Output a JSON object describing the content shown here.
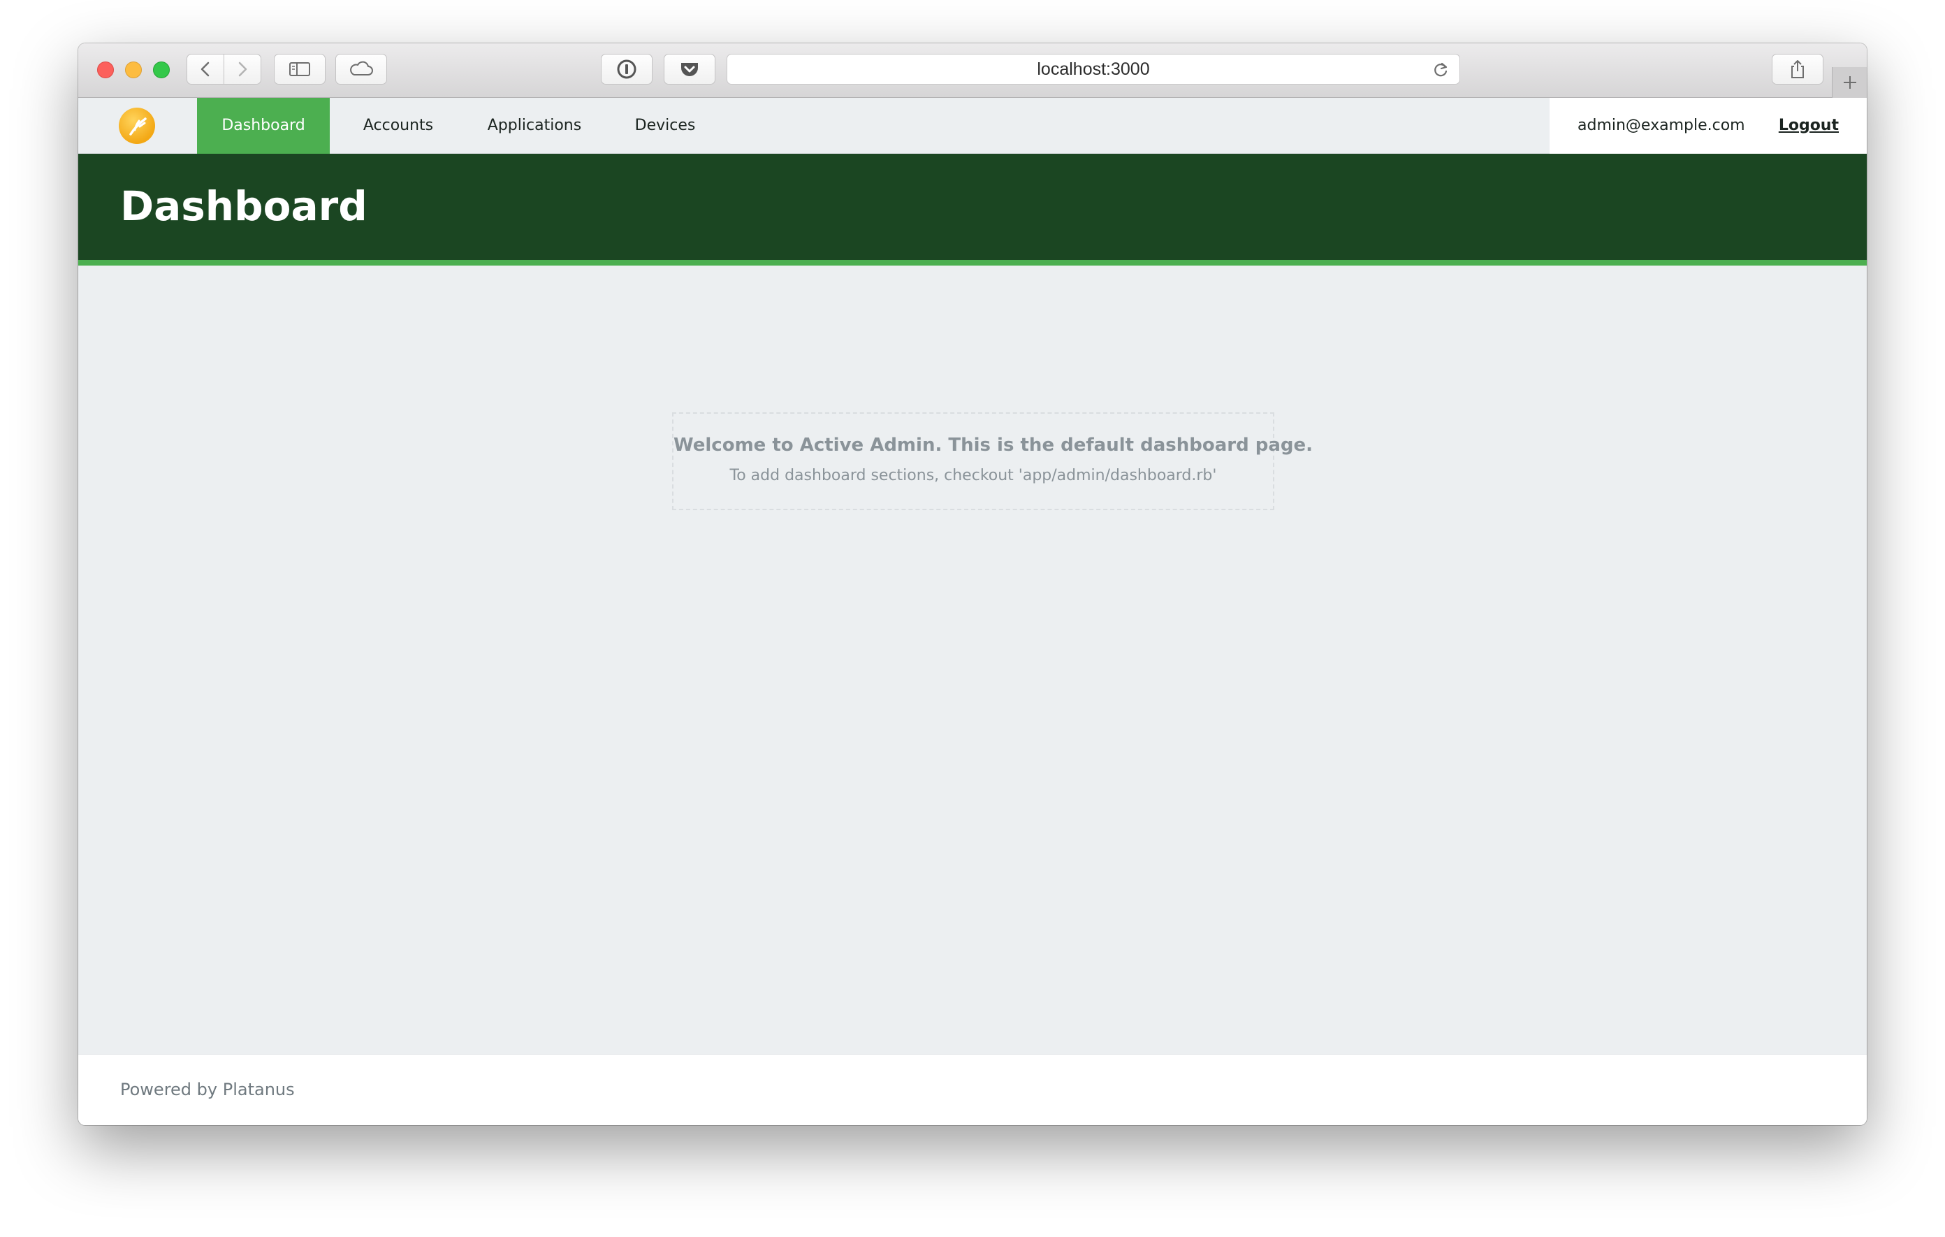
{
  "browser": {
    "url": "localhost:3000",
    "icons": {
      "back": "chevron-left-icon",
      "forward": "chevron-right-icon",
      "sidebar": "sidebar-icon",
      "cloud": "icloud-tabs-icon",
      "onepassword": "1password-icon",
      "pocket": "pocket-icon",
      "reload": "reload-icon",
      "share": "share-icon",
      "new_tab": "plus-icon"
    }
  },
  "nav": {
    "items": [
      {
        "label": "Dashboard",
        "active": true
      },
      {
        "label": "Accounts",
        "active": false
      },
      {
        "label": "Applications",
        "active": false
      },
      {
        "label": "Devices",
        "active": false
      }
    ],
    "user_email": "admin@example.com",
    "logout_label": "Logout"
  },
  "header": {
    "title": "Dashboard"
  },
  "main": {
    "blank_slate_heading": "Welcome to Active Admin. This is the default dashboard page.",
    "blank_slate_text": "To add dashboard sections, checkout 'app/admin/dashboard.rb'"
  },
  "footer": {
    "text": "Powered by Platanus"
  },
  "colors": {
    "nav_active": "#4caf50",
    "title_bar": "#1b4622",
    "accent_strip": "#4caf50",
    "page_background": "#eceff1",
    "logo": "#f3a815"
  }
}
